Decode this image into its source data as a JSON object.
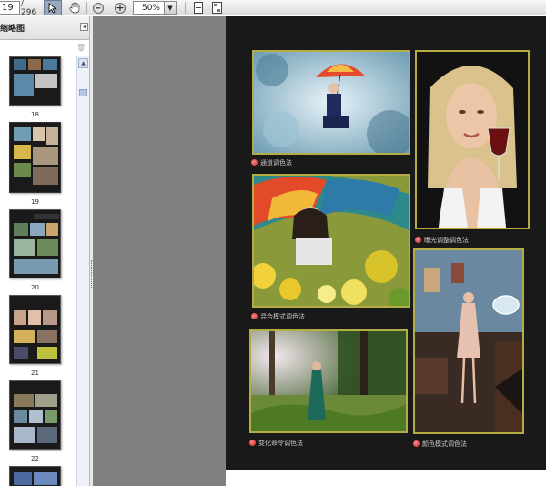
{
  "toolbar": {
    "page_number": "19",
    "page_total": "/ 296",
    "zoom_level": "50%",
    "icons": [
      "select-arrow-icon",
      "hand-tool-icon",
      "zoom-out-icon",
      "zoom-in-icon",
      "fit-page-icon",
      "fit-width-icon"
    ]
  },
  "panel": {
    "title": "缩略图",
    "thumbnails": [
      {
        "label": "18"
      },
      {
        "label": "19"
      },
      {
        "label": "20"
      },
      {
        "label": "21"
      },
      {
        "label": "22"
      }
    ]
  },
  "page": {
    "photos": [
      {
        "name": "umbrella-girl-blue-forest-photo",
        "caption": "通道调色法"
      },
      {
        "name": "blonde-woman-wine-glass-photo",
        "caption": "曝光调整调色法"
      },
      {
        "name": "umbrella-girl-yellow-flowers-photo",
        "caption": "混合模式调色法"
      },
      {
        "name": "woman-green-dress-forest-photo",
        "caption": "变化命令调色法"
      },
      {
        "name": "woman-dress-interior-photo",
        "caption": "颜色模式调色法"
      }
    ]
  }
}
